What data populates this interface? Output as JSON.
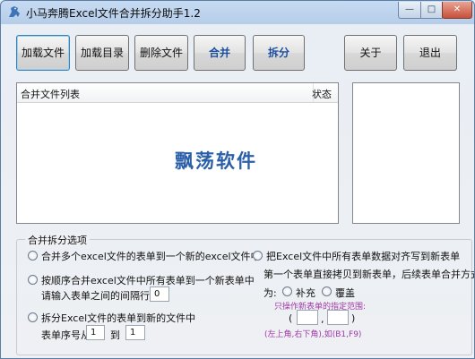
{
  "window": {
    "title": "小马奔腾Excel文件合并拆分助手1.2",
    "caption": {
      "minimize": "—",
      "maximize": "□",
      "close": "✕"
    }
  },
  "toolbar": {
    "load_files": "加载文件",
    "load_dir": "加载目录",
    "delete_files": "删除文件",
    "merge": "合并",
    "split": "拆分",
    "about": "关于",
    "exit": "退出"
  },
  "file_list": {
    "col_files": "合并文件列表",
    "col_status": "状态",
    "watermark": "飘荡软件"
  },
  "options": {
    "title": "合并拆分选项",
    "opt1": "合并多个excel文件的表单到一个新的excel文件中",
    "opt2": "按顺序合并excel文件中所有表单到一个新表单中",
    "opt2_interval_label": "请输入表单之间的间隔行数",
    "opt2_interval_value": "0",
    "opt3": "拆分Excel文件的表单到新的文件中",
    "opt3_seq_from": "表单序号从",
    "opt3_seq_from_value": "1",
    "opt3_to": "到",
    "opt3_seq_to_value": "1",
    "opt4": "把Excel文件中所有表单数据对齐写到新表单",
    "opt4_desc": "第一个表单直接拷贝到新表单，后续表单合并方式",
    "opt4_mode_label": "为:",
    "opt4_mode_fill": "补充",
    "opt4_mode_overwrite": "覆盖",
    "opt4_range_tip": "只操作新表单的指定范围:",
    "opt4_range_open": "(",
    "opt4_range_comma": ",",
    "opt4_range_close": ")",
    "opt4_range_example": "(左上角,右下角),如(B1,F9)",
    "opt4_range_start_value": "",
    "opt4_range_end_value": ""
  }
}
